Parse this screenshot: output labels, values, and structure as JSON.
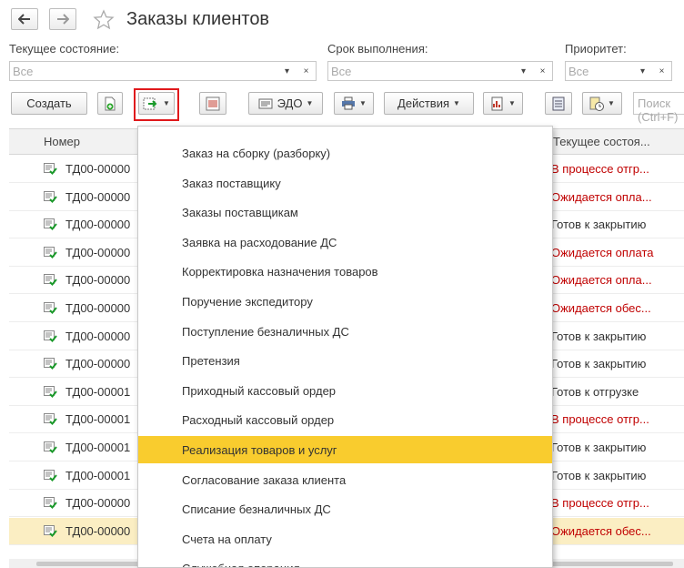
{
  "window": {
    "title": "Заказы клиентов"
  },
  "icons": {
    "back": "arrow-left-icon",
    "forward": "arrow-right-icon",
    "favorite": "star-icon",
    "row": "document-check-icon"
  },
  "filters": [
    {
      "label": "Текущее состояние:",
      "value": "Все"
    },
    {
      "label": "Срок выполнения:",
      "value": "Все"
    },
    {
      "label": "Приоритет:",
      "value": "Все"
    }
  ],
  "filter_buttons": {
    "dropdown": "▾",
    "clear": "×"
  },
  "toolbar": {
    "create": "Создать",
    "edo": "ЭДО",
    "actions": "Действия",
    "search_placeholder": "Поиск (Ctrl+F)"
  },
  "table": {
    "columns": [
      "Номер",
      "Текущее состоя..."
    ],
    "rows": [
      {
        "number": "ТД00-00000",
        "status": "В процессе отгр..."
      },
      {
        "number": "ТД00-00000",
        "status": "Ожидается опла..."
      },
      {
        "number": "ТД00-00000",
        "status": "Готов к закрытию"
      },
      {
        "number": "ТД00-00000",
        "status": "Ожидается оплата"
      },
      {
        "number": "ТД00-00000",
        "status": "Ожидается опла..."
      },
      {
        "number": "ТД00-00000",
        "status": "Ожидается обес..."
      },
      {
        "number": "ТД00-00000",
        "status": "Готов к закрытию"
      },
      {
        "number": "ТД00-00000",
        "status": "Готов к закрытию"
      },
      {
        "number": "ТД00-00001",
        "status": "Готов к отгрузке"
      },
      {
        "number": "ТД00-00001",
        "status": "В процессе отгр..."
      },
      {
        "number": "ТД00-00001",
        "status": "Готов к закрытию"
      },
      {
        "number": "ТД00-00001",
        "status": "Готов к закрытию"
      },
      {
        "number": "ТД00-00000",
        "status": "В процессе отгр..."
      },
      {
        "number": "ТД00-00000",
        "status": "Ожидается обес..."
      }
    ]
  },
  "menu": {
    "items": [
      "Заказ на сборку (разборку)",
      "Заказ поставщику",
      "Заказы поставщикам",
      "Заявка на расходование ДС",
      "Корректировка назначения товаров",
      "Поручение экспедитору",
      "Поступление безналичных ДС",
      "Претензия",
      "Приходный кассовый ордер",
      "Расходный кассовый ордер",
      "Реализация товаров и услуг",
      "Согласование заказа клиента",
      "Списание безналичных ДС",
      "Счета на оплату",
      "Служебная операция"
    ],
    "highlighted": "Реализация товаров и услуг"
  },
  "colors": {
    "highlight": "#f9cc2e",
    "selected_row": "#fbeec3",
    "status_red": "#c00000",
    "frame_red": "#e0191c",
    "icon_green": "#1a9a2a"
  }
}
